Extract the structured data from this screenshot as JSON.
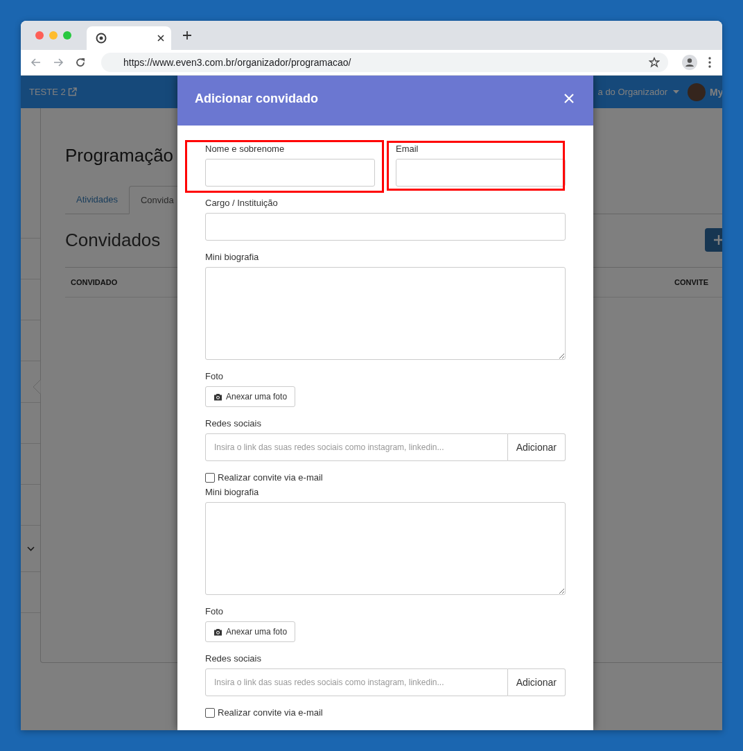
{
  "browser": {
    "url": "https://www.even3.com.br/organizador/programacao/"
  },
  "navbar": {
    "event": "TESTE 2",
    "menu": "a do Organizador",
    "user": "My"
  },
  "page": {
    "title": "Programação",
    "tabs": [
      {
        "label": "Atividades",
        "selected": false
      },
      {
        "label": "Convida",
        "selected": true
      }
    ],
    "section_title": "Convidados",
    "columns": [
      "CONVIDADO",
      "CONVITE"
    ]
  },
  "modal": {
    "title": "Adicionar convidado",
    "rows": [
      {
        "fields": [
          {
            "kind": "text",
            "label": "Nome e sobrenome",
            "highlighted": true
          },
          {
            "kind": "text",
            "label": "Email",
            "highlighted": true
          }
        ]
      },
      {
        "fields": [
          {
            "kind": "text",
            "label": "Cargo / Instituição",
            "highlighted": false
          }
        ]
      },
      {
        "fields": [
          {
            "kind": "textarea",
            "label": "Mini biografia"
          }
        ]
      },
      {
        "fields": [
          {
            "kind": "photo",
            "label": "Foto",
            "button": "Anexar uma foto"
          }
        ]
      },
      {
        "fields": [
          {
            "kind": "social",
            "label": "Redes sociais",
            "placeholder": "Insira o link das suas redes sociais como instagram, linkedin...",
            "button": "Adicionar"
          }
        ]
      },
      {
        "fields": [
          {
            "kind": "checkbox",
            "label": "Realizar convite via e-mail",
            "checked": false
          }
        ]
      },
      {
        "fields": [
          {
            "kind": "textarea",
            "label": "Mini biografia"
          }
        ]
      },
      {
        "fields": [
          {
            "kind": "photo",
            "label": "Foto",
            "button": "Anexar uma foto"
          }
        ]
      },
      {
        "fields": [
          {
            "kind": "social",
            "label": "Redes sociais",
            "placeholder": "Insira o link das suas redes sociais como instagram, linkedin...",
            "button": "Adicionar"
          }
        ]
      },
      {
        "fields": [
          {
            "kind": "checkbox",
            "label": "Realizar convite via e-mail",
            "checked": false
          }
        ]
      }
    ]
  }
}
